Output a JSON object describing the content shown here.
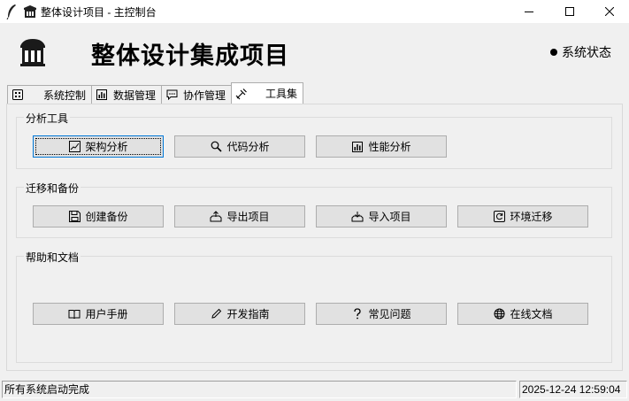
{
  "window": {
    "title": "整体设计项目 - 主控制台",
    "minimize_icon": "minimize-icon",
    "maximize_icon": "maximize-icon",
    "close_icon": "close-icon"
  },
  "header": {
    "title": "整体设计集成项目",
    "status_label": "系统状态"
  },
  "tabs": [
    {
      "label": "系统控制",
      "icon": "grid-icon"
    },
    {
      "label": "数据管理",
      "icon": "bar-chart-icon"
    },
    {
      "label": "协作管理",
      "icon": "chat-icon"
    },
    {
      "label": "工具集",
      "icon": "tools-icon",
      "active": true
    }
  ],
  "groups": {
    "analysis": {
      "label": "分析工具",
      "buttons": [
        {
          "label": "架构分析",
          "icon": "chart-line-icon"
        },
        {
          "label": "代码分析",
          "icon": "magnifier-icon"
        },
        {
          "label": "性能分析",
          "icon": "bar-chart-icon"
        }
      ]
    },
    "migration": {
      "label": "迁移和备份",
      "buttons": [
        {
          "label": "创建备份",
          "icon": "floppy-icon"
        },
        {
          "label": "导出项目",
          "icon": "export-icon"
        },
        {
          "label": "导入项目",
          "icon": "import-icon"
        },
        {
          "label": "环境迁移",
          "icon": "refresh-icon"
        }
      ]
    },
    "help": {
      "label": "帮助和文档",
      "buttons": [
        {
          "label": "用户手册",
          "icon": "book-icon"
        },
        {
          "label": "开发指南",
          "icon": "pen-icon"
        },
        {
          "label": "常见问题",
          "icon": "question-icon"
        },
        {
          "label": "在线文档",
          "icon": "globe-icon"
        }
      ]
    }
  },
  "statusbar": {
    "message": "所有系统启动完成",
    "datetime": "2025-12-24 12:59:04"
  }
}
